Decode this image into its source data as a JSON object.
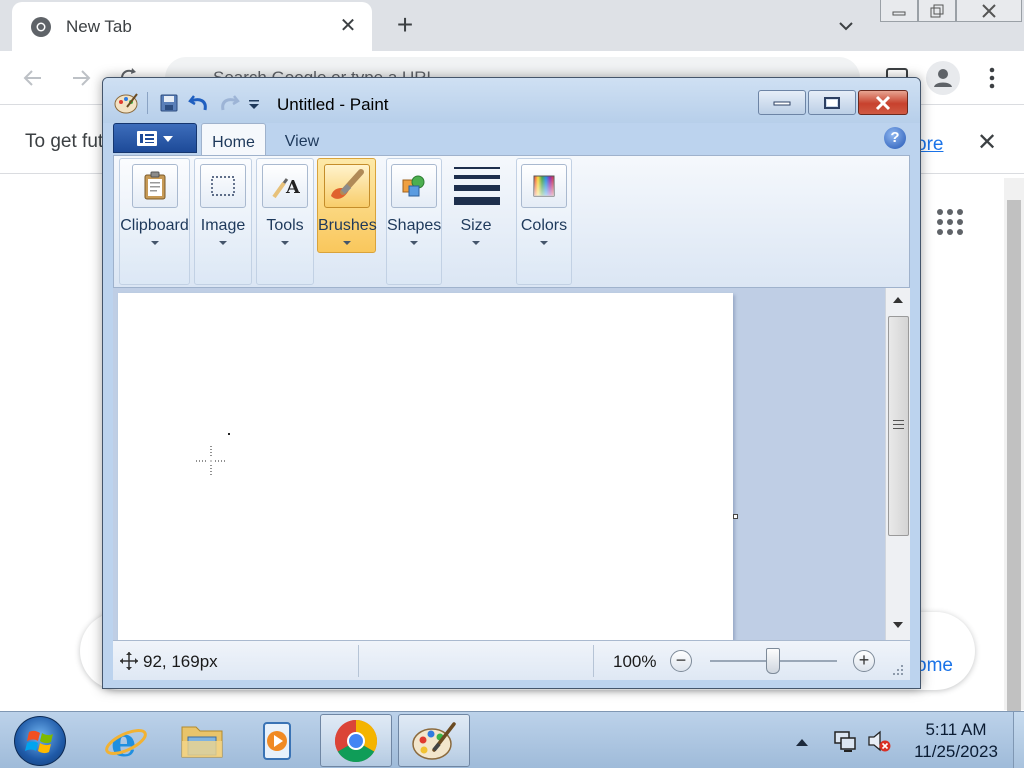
{
  "chrome": {
    "tab_title": "New Tab",
    "omnibox_placeholder": "Search Google or type a URL",
    "info_text": "To get fut",
    "info_link": "ore",
    "shortcut_text": "ome"
  },
  "paint": {
    "title": "Untitled - Paint",
    "tabs": [
      {
        "label": "Home",
        "active": true
      },
      {
        "label": "View",
        "active": false
      }
    ],
    "help_glyph": "?",
    "groups": [
      {
        "label": "Clipboard",
        "icon": "clipboard-icon"
      },
      {
        "label": "Image",
        "icon": "select-icon"
      },
      {
        "label": "Tools",
        "icon": "tools-icon"
      },
      {
        "label": "Brushes",
        "icon": "brush-icon",
        "active": true
      },
      {
        "label": "Shapes",
        "icon": "shapes-icon"
      },
      {
        "label": "Size",
        "icon": "size-icon"
      },
      {
        "label": "Colors",
        "icon": "colors-icon"
      }
    ],
    "status": {
      "cursor_position": "92, 169px",
      "zoom": "100%",
      "zoom_minus": "−",
      "zoom_plus": "+"
    }
  },
  "taskbar": {
    "items": [
      {
        "name": "internet-explorer",
        "open": false
      },
      {
        "name": "file-explorer",
        "open": false
      },
      {
        "name": "media-player",
        "open": false
      },
      {
        "name": "chrome",
        "open": true
      },
      {
        "name": "paint",
        "open": true
      }
    ],
    "time": "5:11 AM",
    "date": "11/25/2023"
  },
  "colors": {
    "accent_blue": "#1a73e8",
    "paint_frame": "#bcd3ee",
    "brushes_active": "#f9c75c",
    "close_red": "#c7412d"
  }
}
